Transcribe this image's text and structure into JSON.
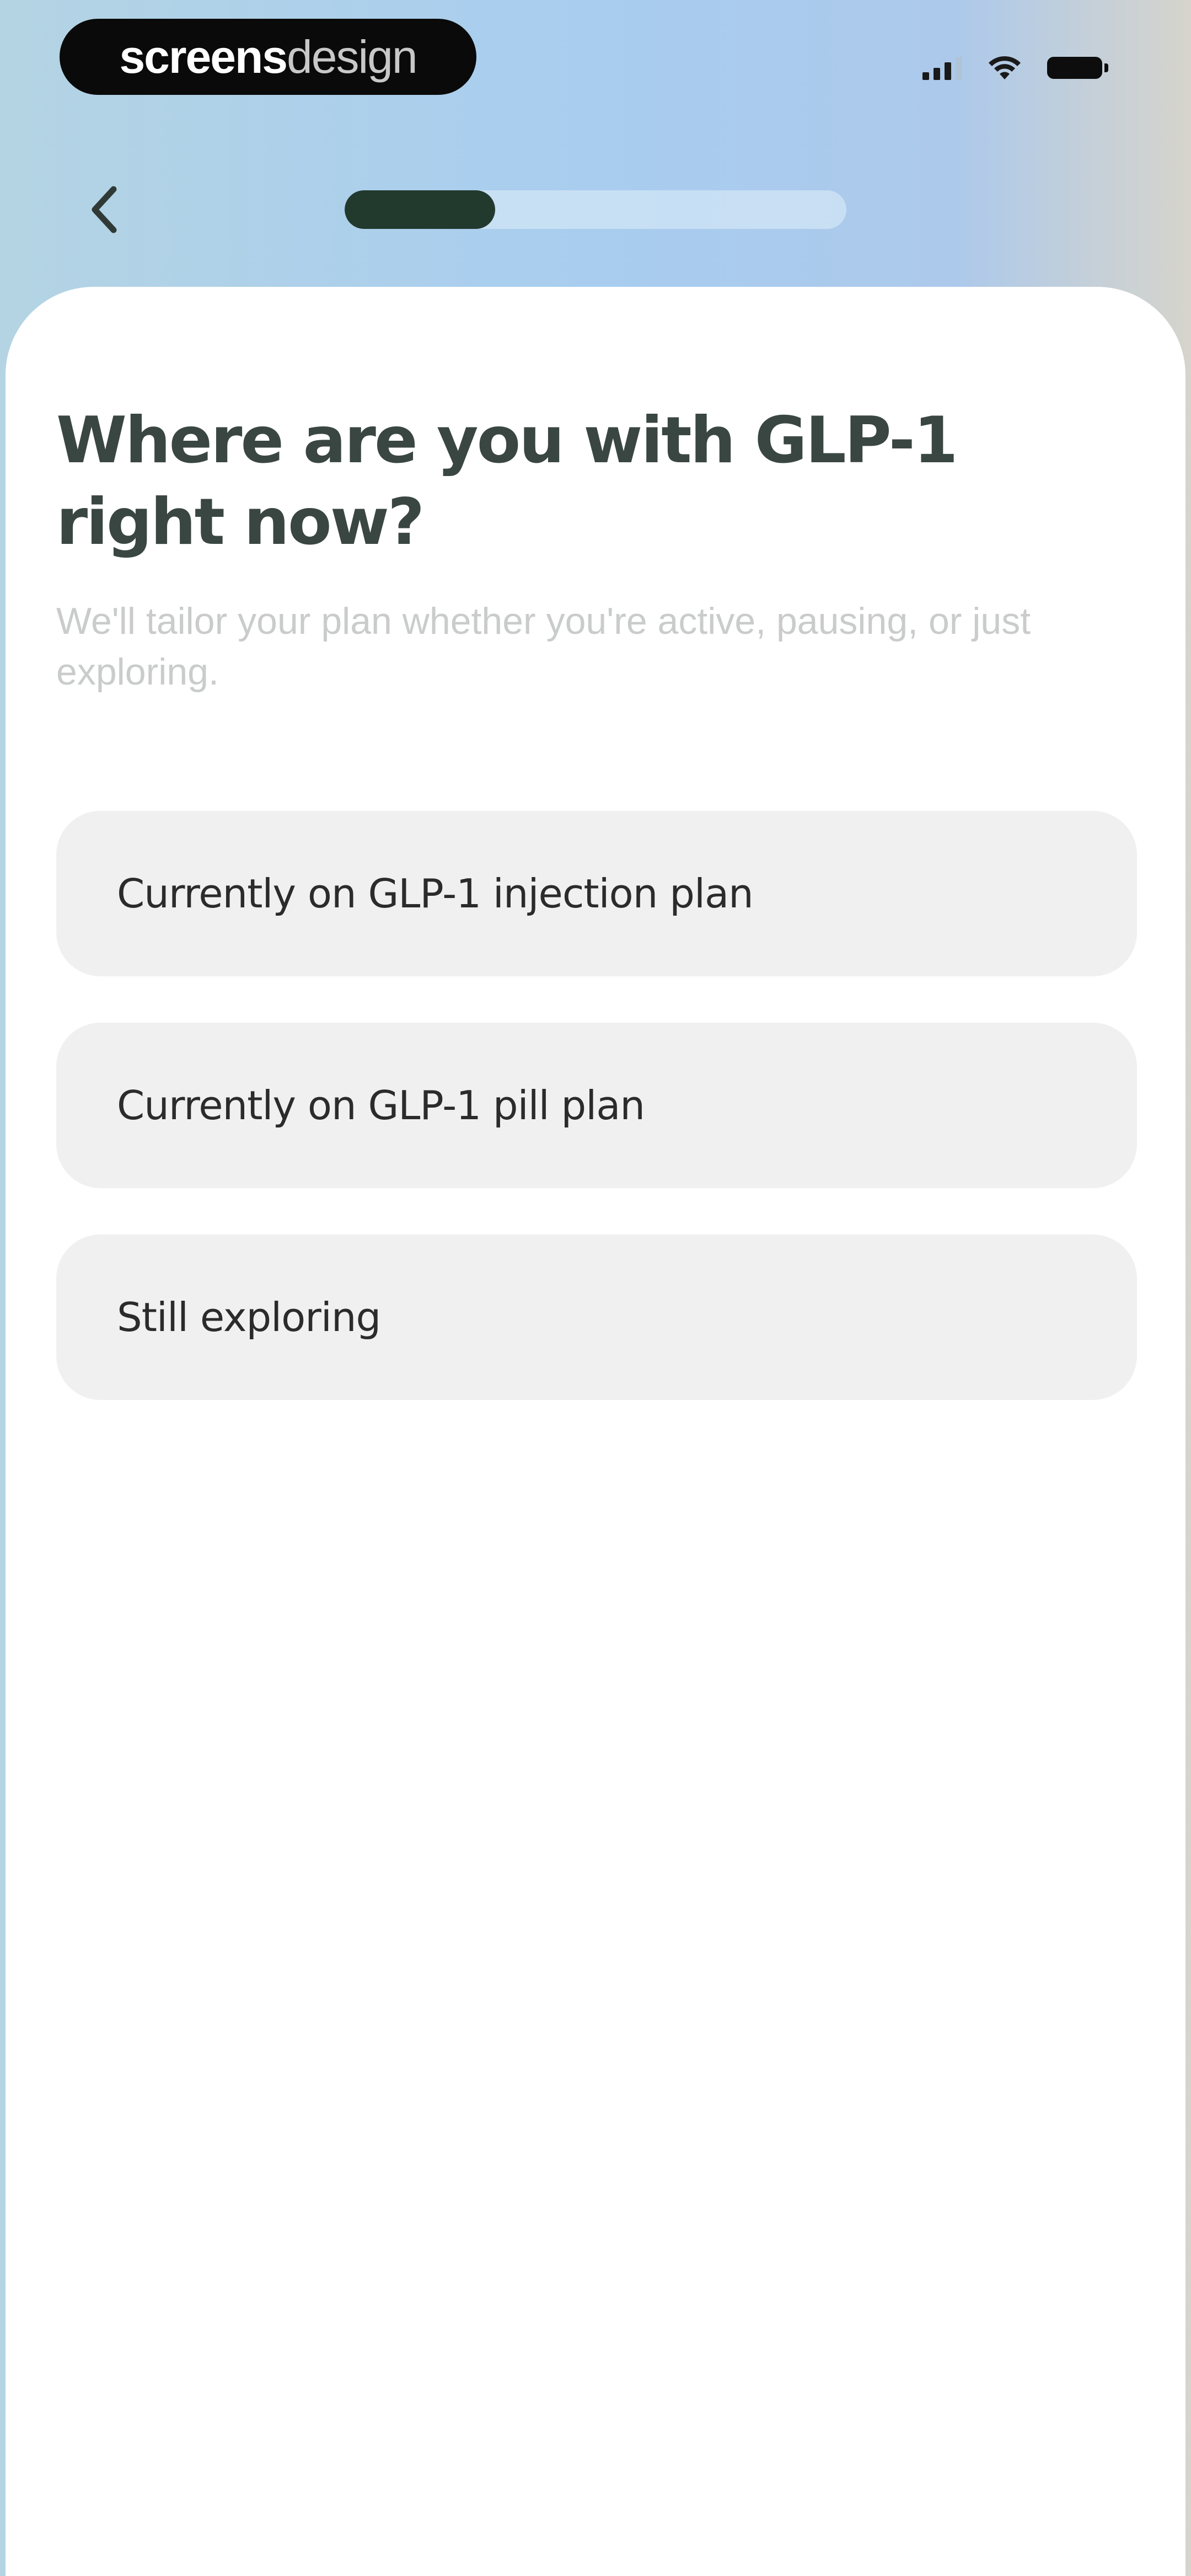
{
  "status_bar": {
    "brand_strong": "screens",
    "brand_light": "design",
    "icons": [
      "signal-icon",
      "wifi-icon",
      "battery-icon"
    ]
  },
  "nav": {
    "back_icon": "chevron-left-icon",
    "progress_fraction": 0.3
  },
  "question": {
    "title": "Where are you with GLP-1 right now?",
    "subtitle": "We'll tailor your plan whether you're active, pausing, or just exploring."
  },
  "options": [
    {
      "label": "Currently on GLP-1 injection plan"
    },
    {
      "label": "Currently on GLP-1 pill plan"
    },
    {
      "label": "Still exploring"
    }
  ],
  "colors": {
    "accent": "#22392e",
    "option_bg": "#f0f0f0",
    "title_text": "#3a4642",
    "subtitle_text": "#c9cccb"
  }
}
